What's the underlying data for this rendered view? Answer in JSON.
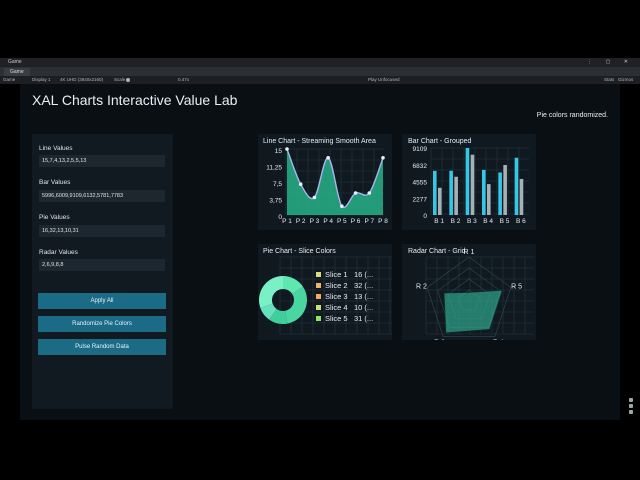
{
  "editor": {
    "window_title": "Game",
    "tab_label": "Game",
    "toolbar": {
      "mode": "Game",
      "display": "Display 1",
      "resolution": "4K UHD (3840x2160)",
      "scale_label": "Scale",
      "scale_value": "0.47x",
      "play_mode": "Play Unfocused",
      "stats": "Stats",
      "gizmos": "Gizmos"
    }
  },
  "app": {
    "title": "XAL Charts Interactive Value Lab",
    "status": "Pie colors randomized."
  },
  "inputs": {
    "line": {
      "label": "Line Values",
      "value": "15,7,4,13,2,5,5,13"
    },
    "bar": {
      "label": "Bar Values",
      "value": "5996,6009,9109,6132,5781,7783"
    },
    "pie": {
      "label": "Pie Values",
      "value": "16,32,13,10,31"
    },
    "radar": {
      "label": "Radar Values",
      "value": "2,6,9,8,8"
    }
  },
  "buttons": {
    "apply": "Apply All",
    "randomize": "Randomize Pie Colors",
    "pulse": "Pulse Random Data"
  },
  "colors": {
    "accent": "#1b6a86",
    "line_fill": "#27b38a",
    "line_stroke": "#a9b4f0",
    "bar_a": "#36c6e6",
    "bar_b": "#a7b0b4",
    "radar_fill": "#2e9e86",
    "pie": [
      "#5ee8b0",
      "#49d6a3",
      "#3fcf9c",
      "#66e0bd",
      "#7af0c6"
    ],
    "legend": [
      "#d9e07a",
      "#f0b36a",
      "#f4a862",
      "#c8e07a",
      "#8fe85c"
    ]
  },
  "chart_data": [
    {
      "type": "area",
      "title": "Line Chart - Streaming Smooth Area",
      "categories": [
        "P 1",
        "P 2",
        "P 3",
        "P 4",
        "P 5",
        "P 6",
        "P 7",
        "P 8"
      ],
      "series": [
        {
          "values": [
            15,
            7,
            4,
            13,
            2,
            5,
            5,
            13
          ]
        }
      ],
      "ytick_labels": [
        "15",
        "11,25",
        "7,5",
        "3,75",
        "0"
      ],
      "ylim": [
        0,
        15
      ]
    },
    {
      "type": "bar",
      "title": "Bar Chart - Grouped",
      "categories": [
        "B 1",
        "B 2",
        "B 3",
        "B 4",
        "B 5",
        "B 6"
      ],
      "series": [
        {
          "values": [
            5996,
            6009,
            9109,
            6132,
            5781,
            7783
          ]
        },
        {
          "values": [
            3700,
            5200,
            8200,
            4200,
            6800,
            4900
          ]
        }
      ],
      "ytick_labels": [
        "9109",
        "6832",
        "4555",
        "2277",
        "0"
      ],
      "ylim": [
        0,
        9109
      ]
    },
    {
      "type": "pie",
      "title": "Pie Chart - Slice Colors",
      "legend": [
        {
          "name": "Slice 1",
          "text": "16 (..."
        },
        {
          "name": "Slice 2",
          "text": "32 (..."
        },
        {
          "name": "Slice 3",
          "text": "13 (..."
        },
        {
          "name": "Slice 4",
          "text": "10 (..."
        },
        {
          "name": "Slice 5",
          "text": "31 (..."
        }
      ],
      "values": [
        16,
        32,
        13,
        10,
        31
      ]
    },
    {
      "type": "radar",
      "title": "Radar Chart - Grid",
      "axes": [
        "R 1",
        "R 5",
        "R 4",
        "R 3",
        "R 2"
      ],
      "values": [
        2,
        8,
        8,
        9,
        6
      ],
      "max": 10
    }
  ]
}
